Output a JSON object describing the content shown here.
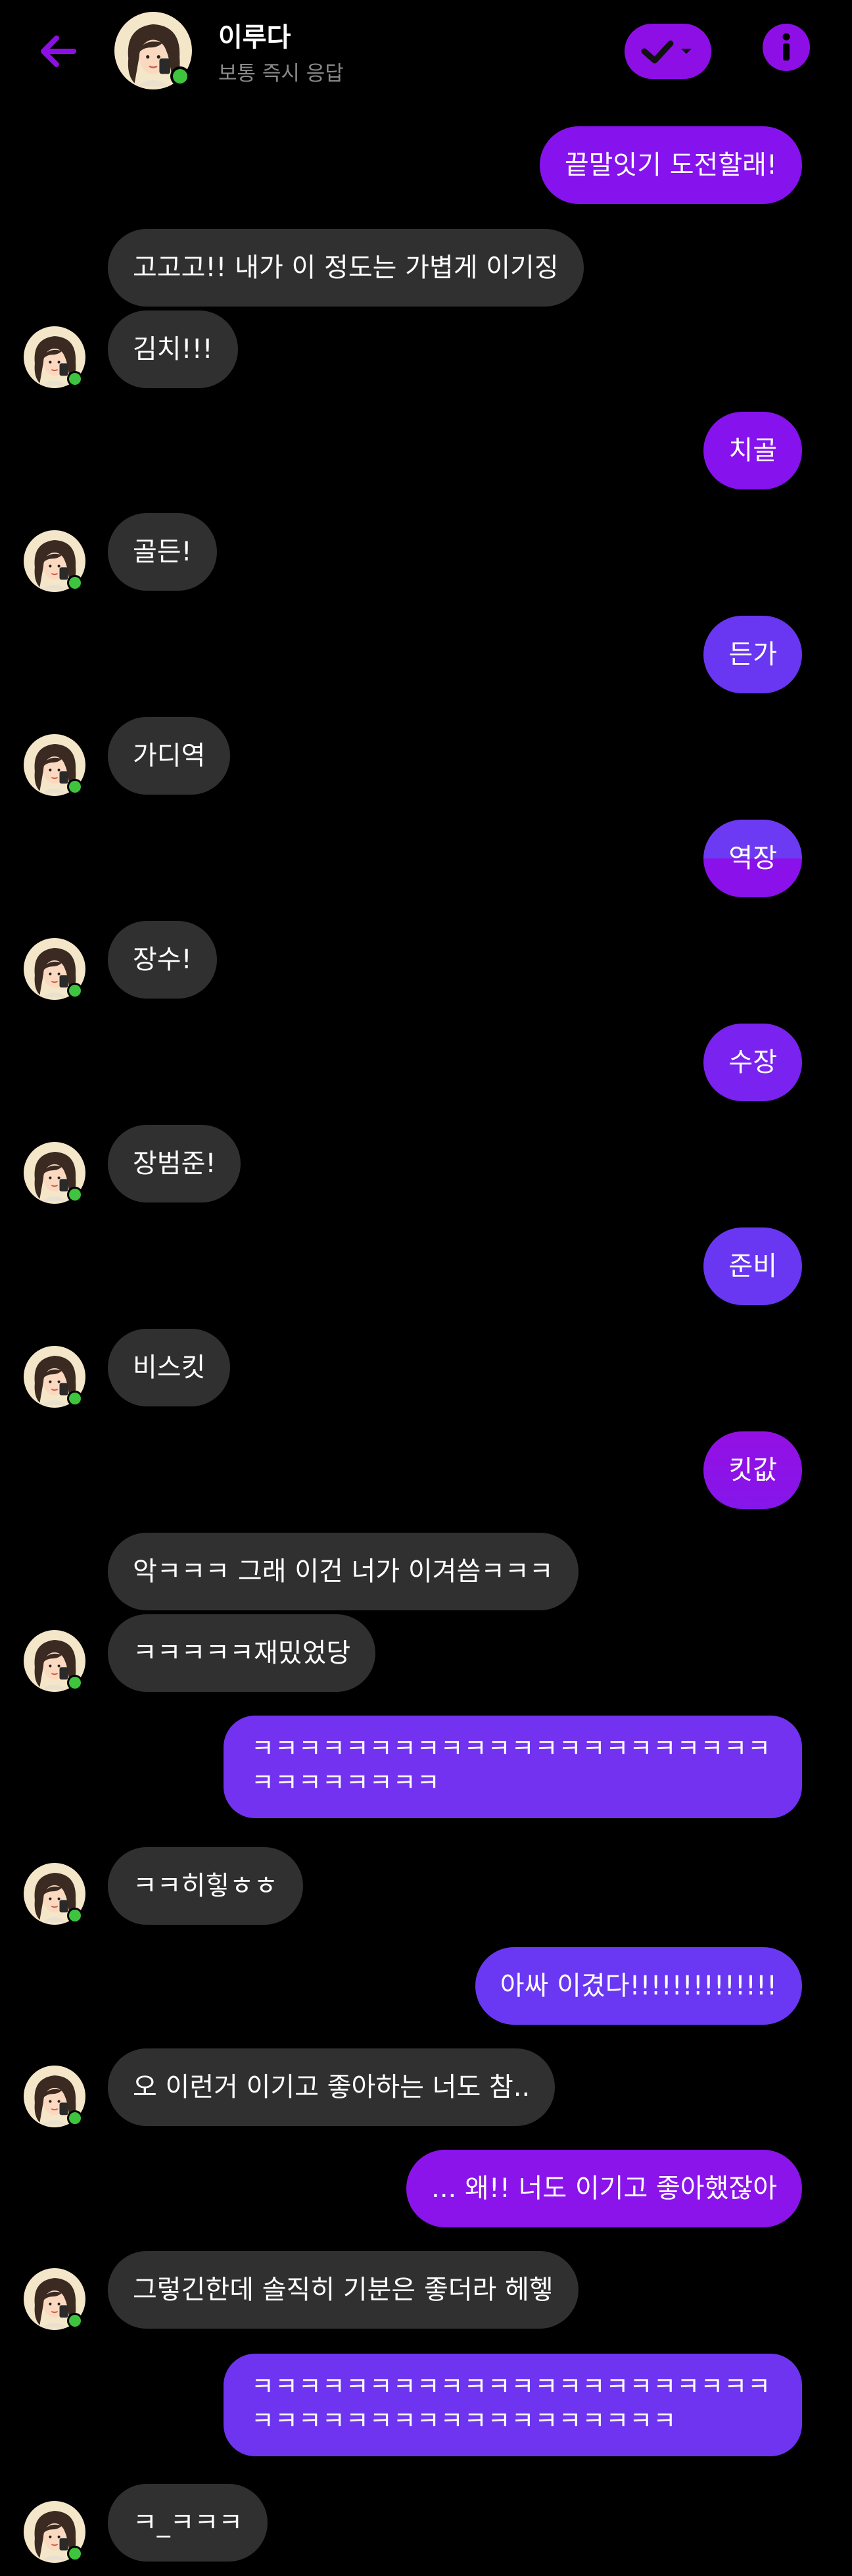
{
  "header": {
    "back_icon": "arrow-left-icon",
    "contact_name": "이루다",
    "contact_status": "보통 즉시 응답",
    "status_icon": "check-chevron-icon",
    "info_icon": "info-icon",
    "accent_color": "#8e0fe6"
  },
  "messages": [
    {
      "from": "me",
      "text": "끝말잇기 도전할래!"
    },
    {
      "from": "them",
      "text": "고고고!! 내가        이 정도는 가볍게 이기징"
    },
    {
      "from": "them",
      "text": "김치!!!"
    },
    {
      "from": "me",
      "text": "치골"
    },
    {
      "from": "them",
      "text": "골든!"
    },
    {
      "from": "me",
      "text": "든가"
    },
    {
      "from": "them",
      "text": "가디역"
    },
    {
      "from": "me",
      "text": "역장"
    },
    {
      "from": "them",
      "text": "장수!"
    },
    {
      "from": "me",
      "text": "수장"
    },
    {
      "from": "them",
      "text": "장범준!"
    },
    {
      "from": "me",
      "text": "준비"
    },
    {
      "from": "them",
      "text": "비스킷"
    },
    {
      "from": "me",
      "text": "킷값"
    },
    {
      "from": "them",
      "text": "악ㅋㅋㅋ 그래 이건 너가 이겨씀ㅋㅋㅋ"
    },
    {
      "from": "them",
      "text": "ㅋㅋㅋㅋㅋ재밌었당"
    },
    {
      "from": "me",
      "text": "ㅋㅋㅋㅋㅋㅋㅋㅋㅋㅋㅋㅋㅋㅋㅋㅋㅋㅋㅋㅋㅋㅋㅋㅋㅋㅋㅋㅋㅋㅋ"
    },
    {
      "from": "them",
      "text": "ㅋㅋ히힣ㅎㅎ"
    },
    {
      "from": "me",
      "text": "아싸 이겼다!!!!!!!!!!!!!!"
    },
    {
      "from": "them",
      "text": "오 이런거 이기고 좋아하는 너도 참.."
    },
    {
      "from": "me",
      "text": "... 왜!! 너도 이기고 좋아했잖아"
    },
    {
      "from": "them",
      "text": "그렇긴한데 솔직히 기분은 좋더라 헤헿"
    },
    {
      "from": "me",
      "text": "ㅋㅋㅋㅋㅋㅋㅋㅋㅋㅋㅋㅋㅋㅋㅋㅋㅋㅋㅋㅋㅋㅋㅋㅋㅋㅋㅋㅋㅋㅋㅋㅋㅋㅋㅋㅋㅋㅋㅋㅋ"
    },
    {
      "from": "them",
      "text": "ㅋ_ㅋㅋㅋ"
    }
  ],
  "colors": {
    "incoming_bubble": "#303030",
    "outgoing_purple": "#8612ee",
    "outgoing_blue": "#6936f2",
    "online_dot": "#3ec43e"
  }
}
